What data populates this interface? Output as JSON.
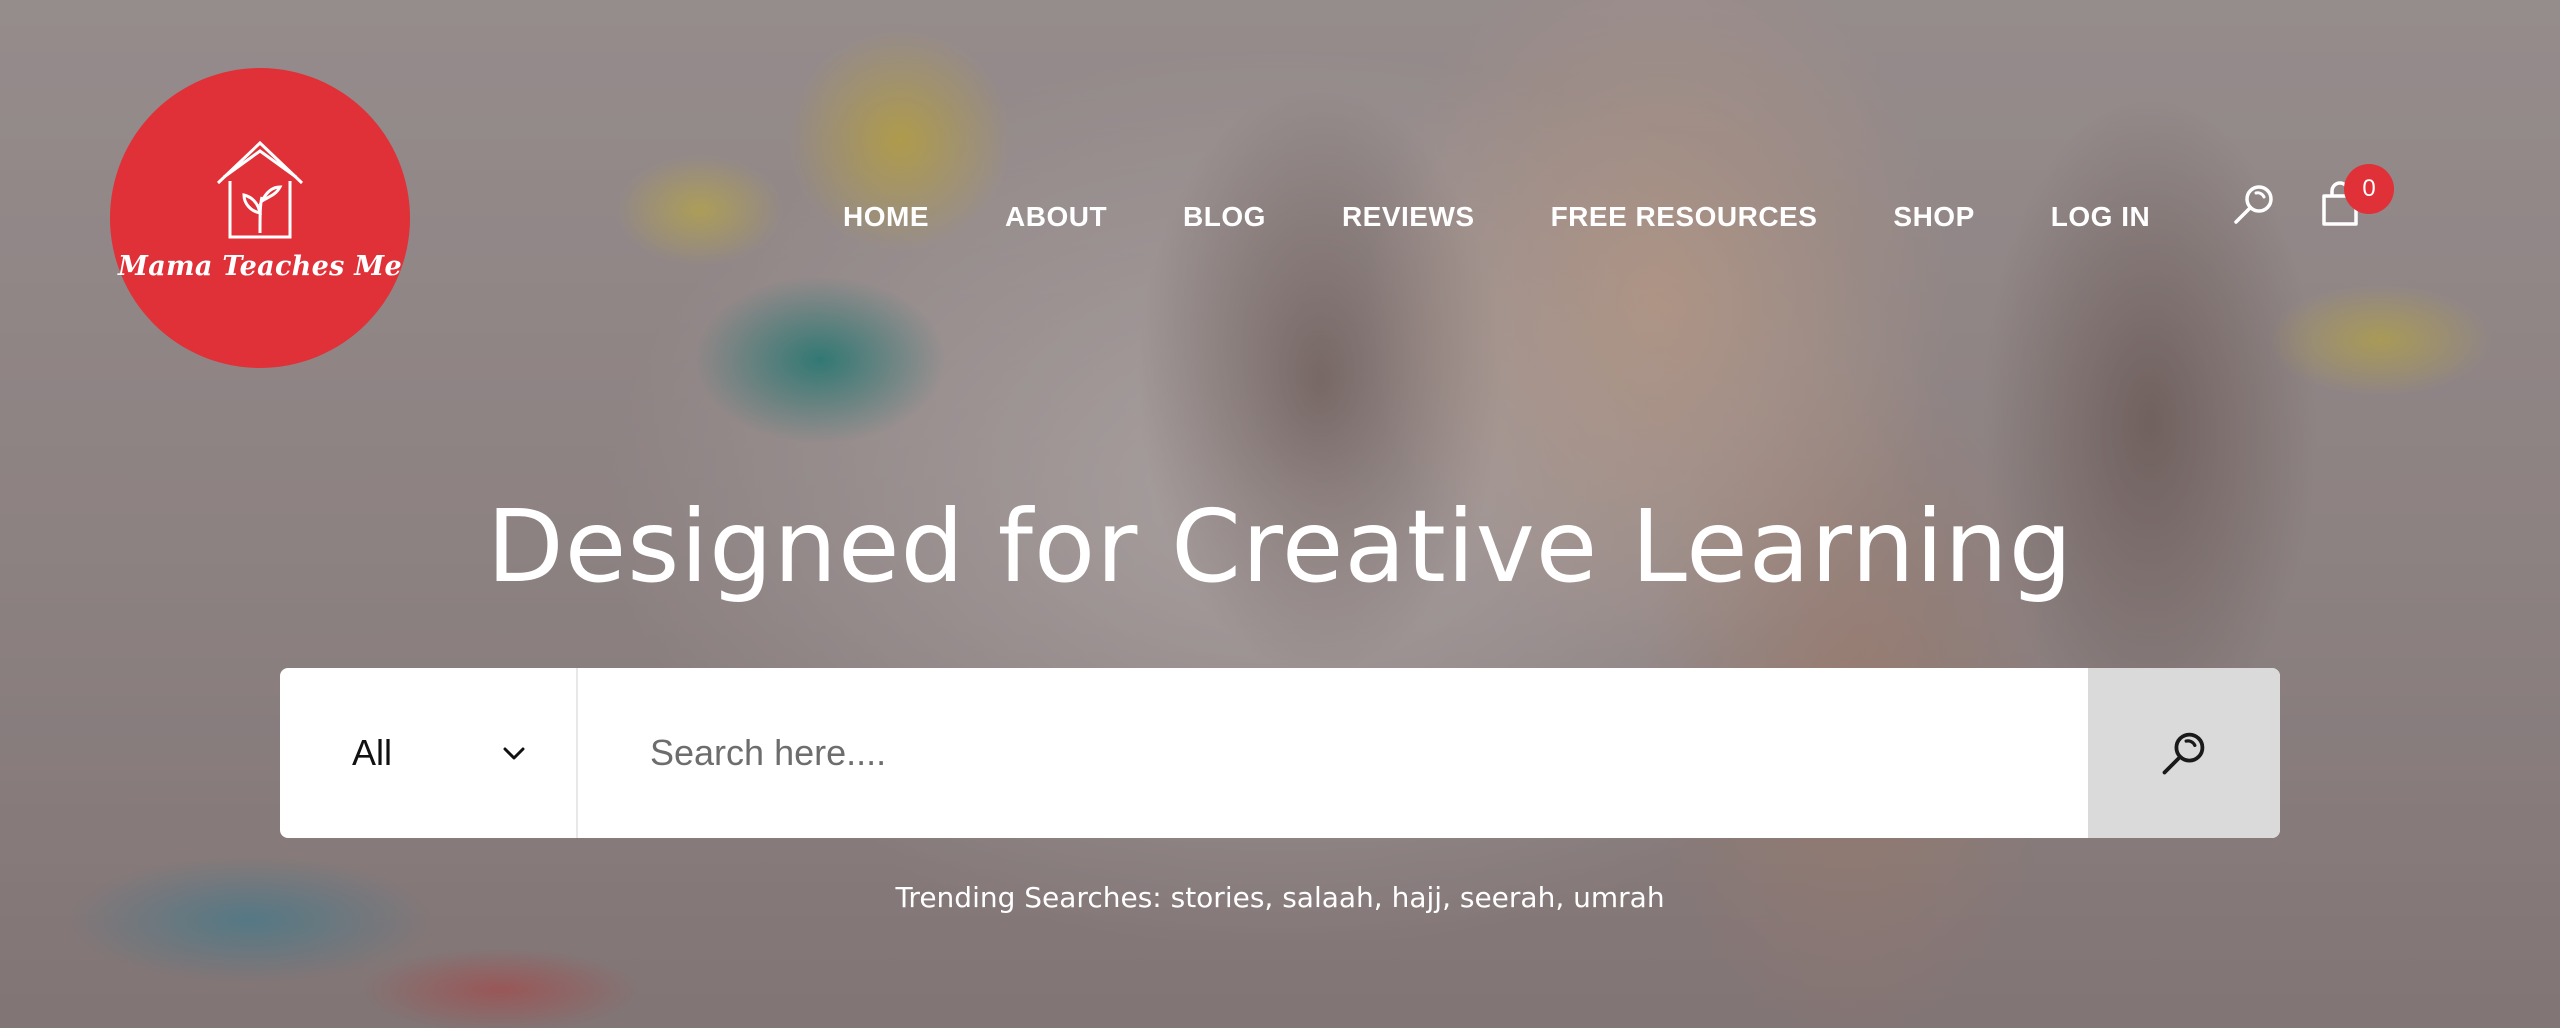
{
  "brand": {
    "name": "Mama Teaches Me",
    "color": "#e03038"
  },
  "nav": {
    "items": [
      {
        "label": "HOME"
      },
      {
        "label": "ABOUT"
      },
      {
        "label": "BLOG"
      },
      {
        "label": "REVIEWS"
      },
      {
        "label": "FREE RESOURCES"
      },
      {
        "label": "SHOP"
      },
      {
        "label": "LOG IN"
      }
    ],
    "search_icon": "search-icon",
    "cart_icon": "shopping-bag-icon",
    "cart_count": "0"
  },
  "hero": {
    "headline": "Designed for Creative Learning"
  },
  "search": {
    "category": "All",
    "placeholder": "Search here....",
    "button_icon": "search-icon"
  },
  "trending": {
    "text": "Trending Searches: stories, salaah, hajj, seerah, umrah"
  }
}
